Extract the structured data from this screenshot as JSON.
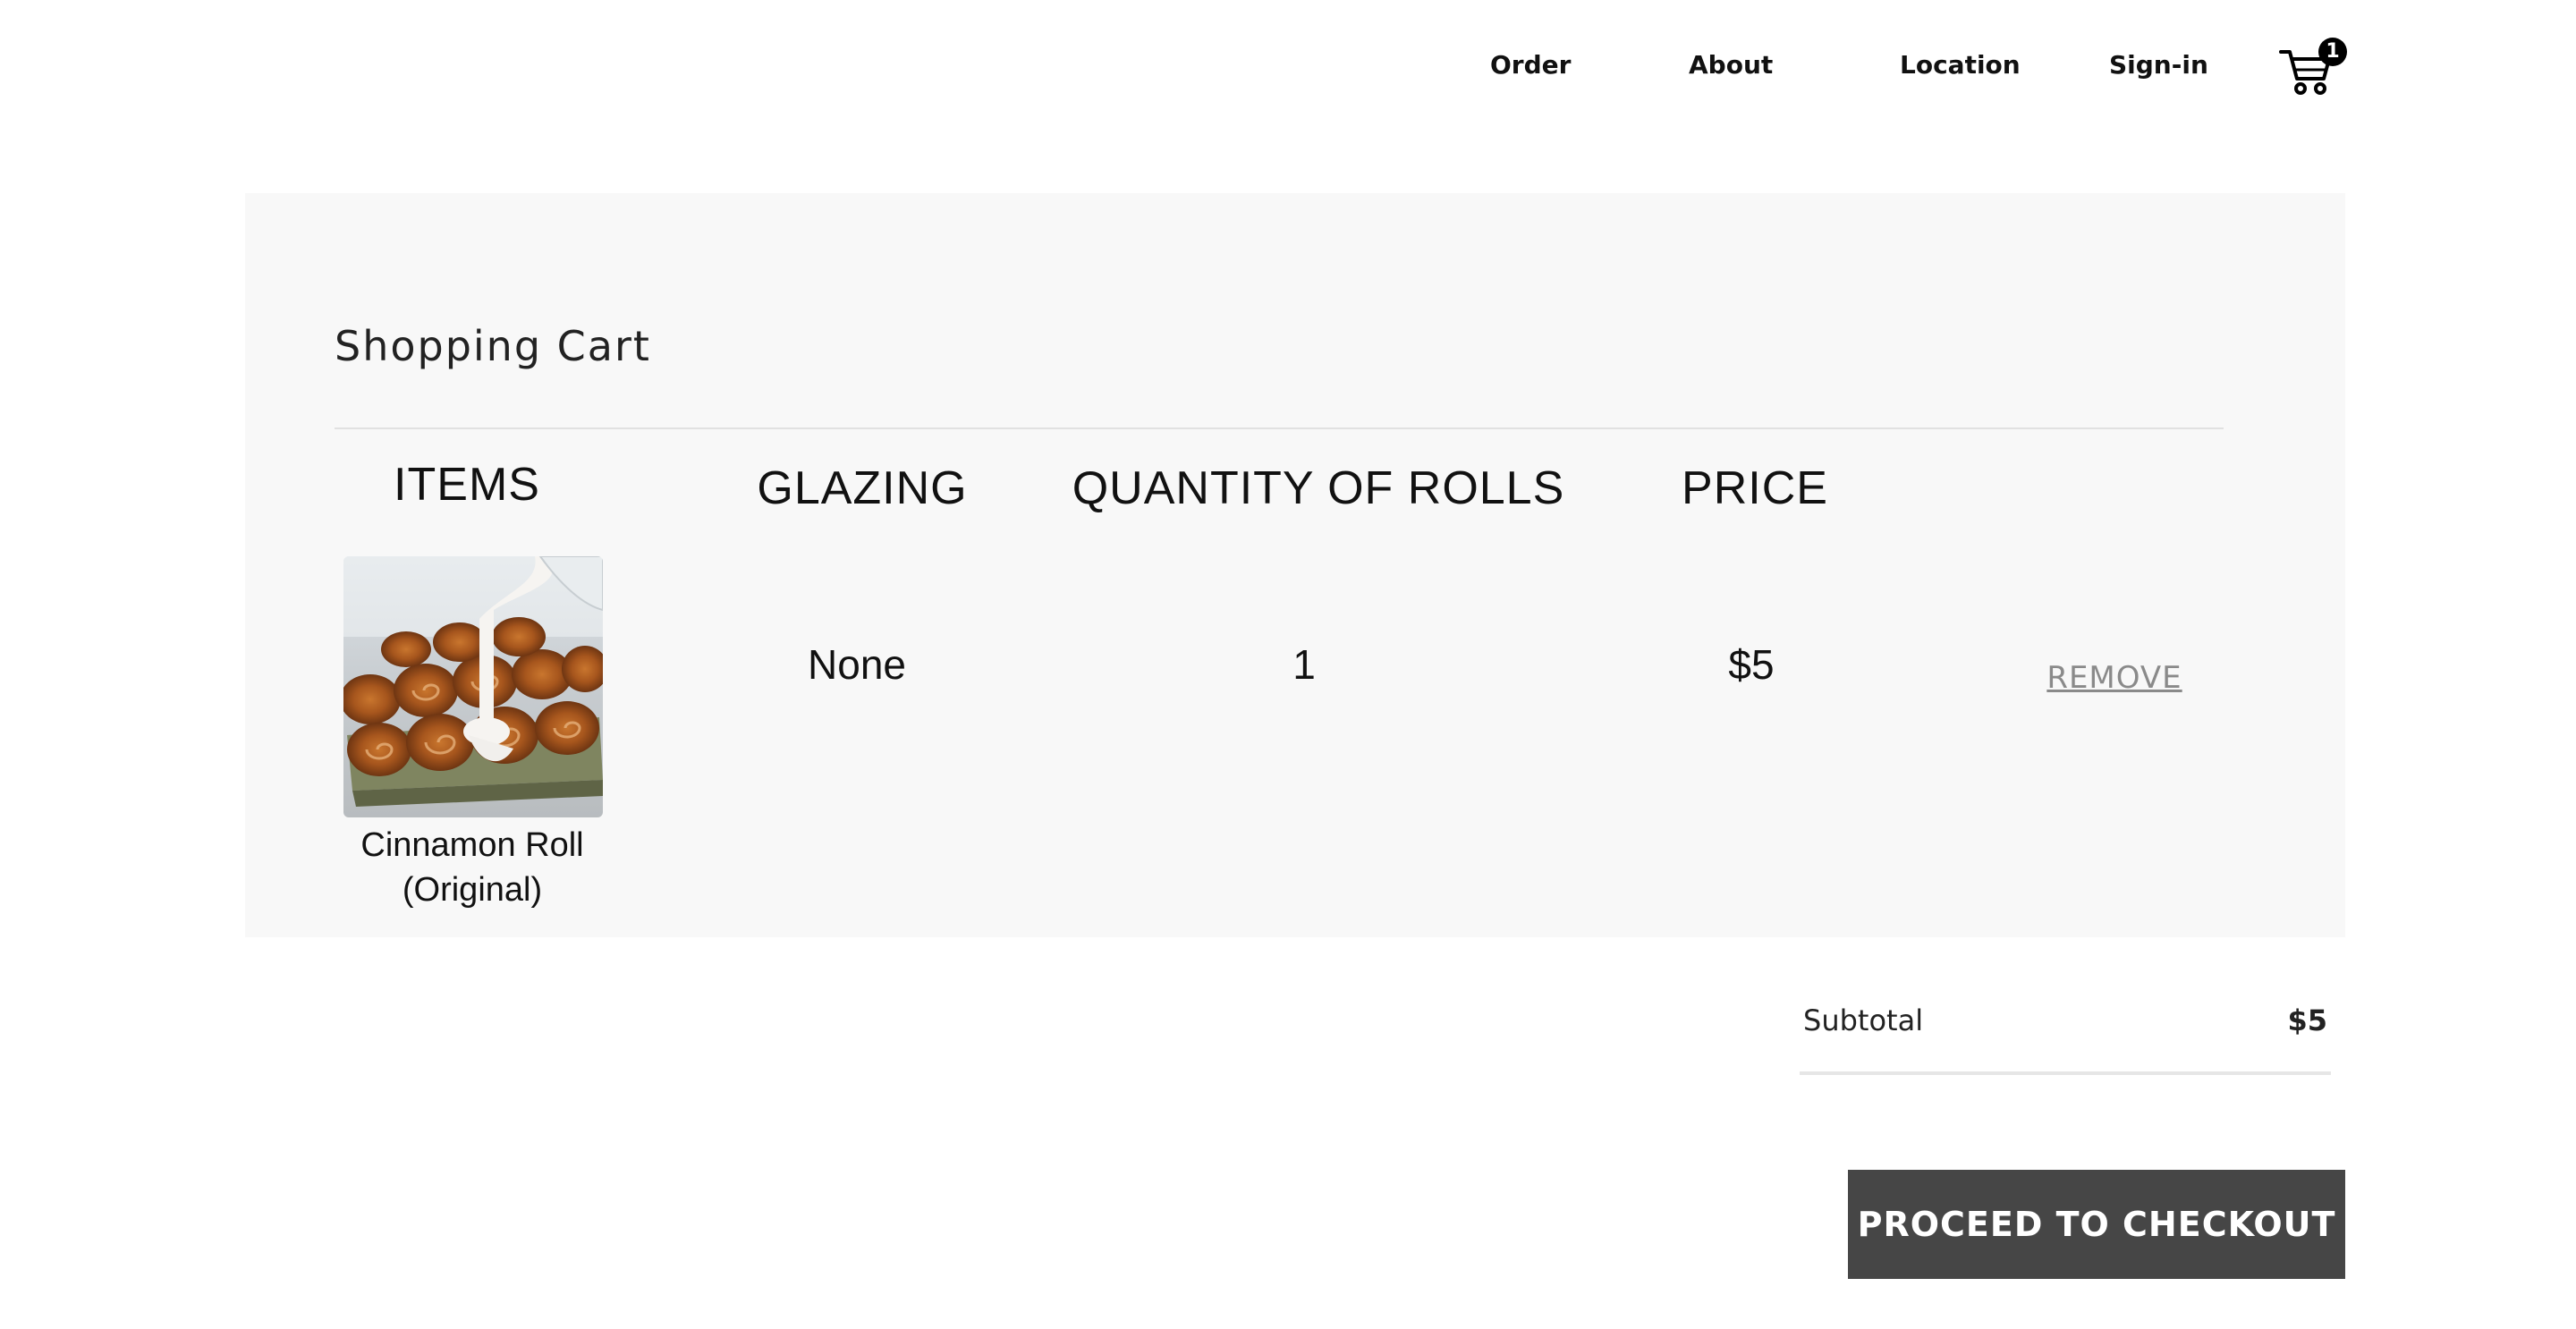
{
  "nav": {
    "links": [
      "Order",
      "About",
      "Location",
      "Sign-in"
    ],
    "cart_icon": "shopping-cart-icon",
    "cart_count": "1"
  },
  "cart": {
    "title": "Shopping Cart",
    "headers": {
      "items": "ITEMS",
      "glazing": "GLAZING",
      "quantity": "QUANTITY OF ROLLS",
      "price": "PRICE"
    },
    "rows": [
      {
        "name_line1": "Cinnamon Roll",
        "name_line2": "(Original)",
        "image": "cinnamon-roll-photo",
        "glazing": "None",
        "quantity": "1",
        "price": "$5",
        "remove_label": "REMOVE"
      }
    ]
  },
  "summary": {
    "subtotal_label": "Subtotal",
    "subtotal_value": "$5",
    "checkout_label": "PROCEED TO CHECKOUT"
  },
  "colors": {
    "panel_bg": "#f8f8f8",
    "checkout_bg": "#464646",
    "remove_link": "#8a8a8a"
  }
}
